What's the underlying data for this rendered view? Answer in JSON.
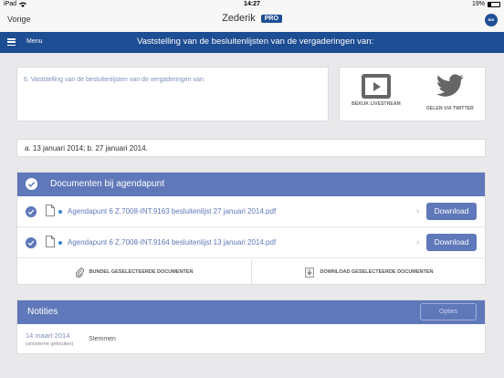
{
  "status": {
    "device": "iPad",
    "time": "14:27",
    "battery": "19%"
  },
  "nav": {
    "back": "Vorige",
    "title": "Zederik",
    "badge": "PRO",
    "logo_text": "BIS"
  },
  "menubar": {
    "menu_label": "Menu",
    "heading": "Vaststelling van de besluitenlijsten van de vergaderingen van:"
  },
  "topic": {
    "text": "6. Vaststelling van de besluitenlijsten van de vergaderingen van:"
  },
  "share": {
    "livestream": "BEKIJK LIVESTREAM",
    "twitter": "DELEN VIA TWITTER"
  },
  "dates": {
    "text": "a. 13 januari 2014;  b. 27 januari 2014."
  },
  "documents": {
    "title": "Documenten bij agendapunt",
    "items": [
      {
        "name": "Agendapunt 6 Z.7008-INT.9163  besluitenlijst 27 januari 2014.pdf",
        "action": "Download"
      },
      {
        "name": "Agendapunt 6 Z.7008-INT.9164  besluitenlijst 13 januari 2014.pdf",
        "action": "Download"
      }
    ],
    "bundle_label": "BUNDEL GESELECTEERDE DOCUMENTEN",
    "download_label": "DOWNLOAD GESELECTEERDE DOCUMENTEN"
  },
  "notes": {
    "title": "Notities",
    "options": "Opties",
    "entry": {
      "date": "14 maart 2014",
      "author": "(anonieme gebruiker)",
      "text": "Stemmen"
    }
  },
  "colors": {
    "brand": "#1d4d93",
    "section_header": "#5f78b9",
    "background": "#e9e9eb"
  }
}
